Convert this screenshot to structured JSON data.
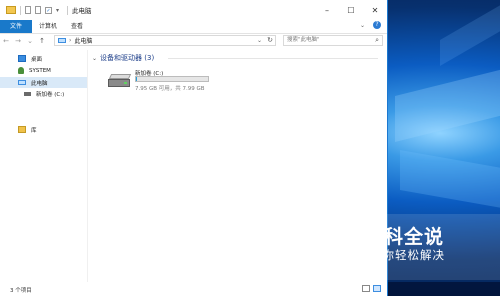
{
  "window": {
    "title": "此电脑",
    "controls": {
      "minimize": "–",
      "maximize": "☐",
      "close": "✕"
    }
  },
  "ribbon": {
    "tabs": [
      "文件",
      "计算机",
      "查看"
    ],
    "expand": "⌄",
    "help": "?"
  },
  "navbar": {
    "back": "←",
    "forward": "→",
    "recent": "⌄",
    "up": "↑",
    "address_crumb": "此电脑",
    "address_sep": "›",
    "search_placeholder": "搜索\"此电脑\""
  },
  "sidebar": {
    "items": [
      {
        "label": "桌面",
        "icon": "desktop-icon"
      },
      {
        "label": "SYSTEM",
        "icon": "user-icon"
      },
      {
        "label": "此电脑",
        "icon": "pc-icon",
        "selected": true
      },
      {
        "label": "新加卷 (C:)",
        "icon": "drive-icon"
      },
      {
        "label": "库",
        "icon": "library-icon"
      }
    ]
  },
  "content": {
    "group_header": "设备和驱动器 (3)",
    "drive": {
      "name": "新加卷 (C:)",
      "free_text": "7.95 GB 可用，共 7.99 GB",
      "used_fraction": 0.005
    }
  },
  "status": {
    "item_count": "3 个项目"
  },
  "watermark": {
    "top": "百科全说",
    "bottom": "助你轻松解决"
  }
}
